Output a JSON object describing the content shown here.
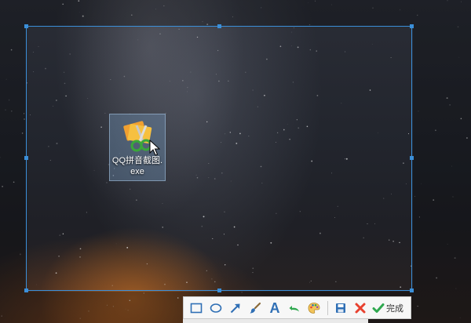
{
  "desktop": {
    "icon": {
      "label_line1": "QQ拼音截图.",
      "label_line2": "exe",
      "icon_name": "scissors-icon"
    }
  },
  "screenshot_tool": {
    "colors": {
      "selection_border": "#3b8fd9",
      "toolbar_bg": "#f7f7f7",
      "accent_blue": "#2f6fb5",
      "cancel_red": "#e8412f",
      "confirm_green": "#2fa84f"
    },
    "toolbar": {
      "text_tool_glyph": "A",
      "done_label": "完成",
      "tools": [
        "rectangle-icon",
        "ellipse-icon",
        "arrow-icon",
        "brush-icon",
        "text-icon",
        "undo-icon",
        "palette-icon",
        "save-icon",
        "cancel-icon",
        "done-check-icon"
      ]
    }
  }
}
